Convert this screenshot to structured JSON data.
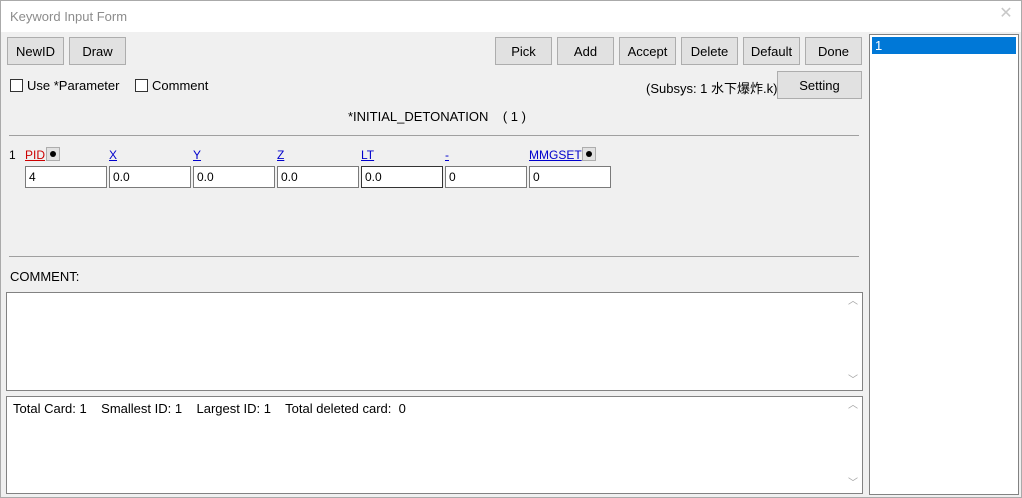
{
  "window": {
    "title": "Keyword Input Form",
    "close_glyph": "✕"
  },
  "toolbar": {
    "newid": "NewID",
    "draw": "Draw",
    "pick": "Pick",
    "add": "Add",
    "accept": "Accept",
    "delete": "Delete",
    "default": "Default",
    "done": "Done",
    "setting": "Setting"
  },
  "options": {
    "use_parameter": "Use *Parameter",
    "comment": "Comment"
  },
  "subsys": "(Subsys: 1 水下爆炸.k)",
  "keyword": {
    "title": "*INITIAL_DETONATION    ( 1 )"
  },
  "card": {
    "row": "1",
    "fields": [
      {
        "label": "PID",
        "value": "4"
      },
      {
        "label": "X",
        "value": "0.0"
      },
      {
        "label": "Y",
        "value": "0.0"
      },
      {
        "label": "Z",
        "value": "0.0"
      },
      {
        "label": "LT",
        "value": "0.0"
      },
      {
        "label": "-",
        "value": "0"
      },
      {
        "label": "MMGSET",
        "value": "0"
      }
    ]
  },
  "comment": {
    "label": "COMMENT:"
  },
  "info": {
    "text": "Total Card: 1    Smallest ID: 1    Largest ID: 1    Total deleted card:  0"
  },
  "list": {
    "items": [
      "1"
    ]
  }
}
